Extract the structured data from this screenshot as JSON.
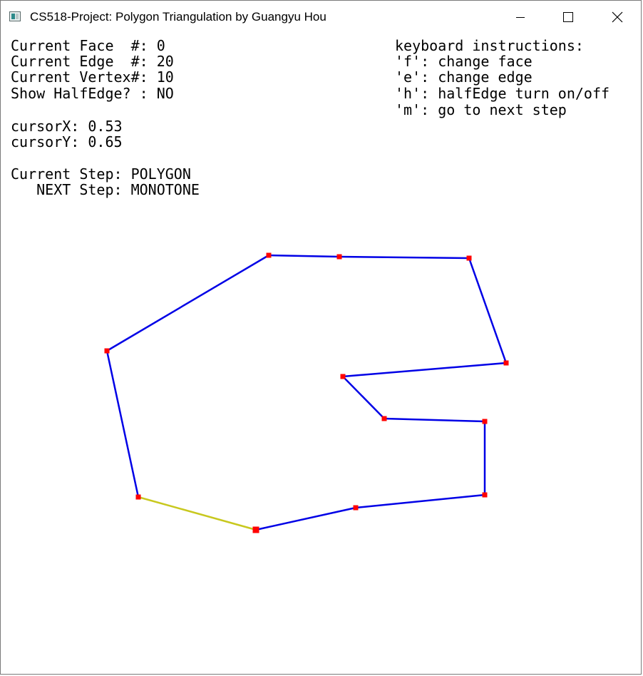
{
  "window": {
    "title": "CS518-Project:  Polygon Triangulation by Guangyu Hou"
  },
  "info": {
    "face": "Current Face  #: 0",
    "edge": "Current Edge  #: 20",
    "vertex": "Current Vertex#: 10",
    "halfedge": "Show HalfEdge? : NO",
    "cursor_x": "cursorX: 0.53",
    "cursor_y": "cursorY: 0.65",
    "current_step": "Current Step: POLYGON",
    "next_step": "   NEXT Step: MONOTONE"
  },
  "instructions": {
    "heading": "keyboard instructions:",
    "f": "'f': change face",
    "e": "'e': change edge",
    "h": "'h': halfEdge turn on/off",
    "m": "'m': go to next step"
  },
  "colors": {
    "edge": "#0000e6",
    "selected_edge": "#c8c81e",
    "vertex": "#ff0000"
  }
}
